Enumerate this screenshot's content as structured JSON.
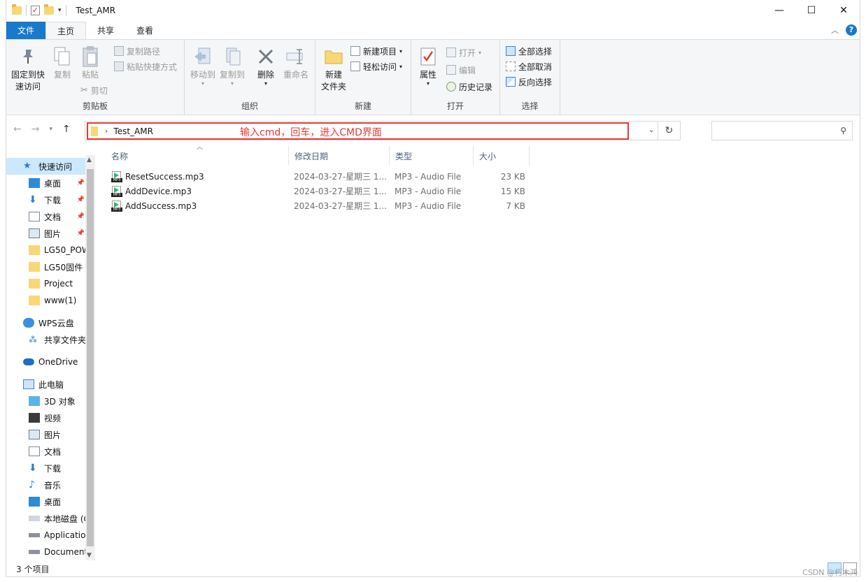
{
  "window": {
    "title": "Test_AMR",
    "controls": {
      "minimize": "—",
      "maximize": "☐",
      "close": "✕"
    }
  },
  "ribbon_tabs": [
    "文件",
    "主页",
    "共享",
    "查看"
  ],
  "ribbon": {
    "clipboard": {
      "label": "剪贴板",
      "pin": "固定到快\n速访问",
      "copy": "复制",
      "paste": "粘贴",
      "copy_path": "复制路径",
      "paste_shortcut": "粘贴快捷方式",
      "cut": "剪切"
    },
    "organize": {
      "label": "组织",
      "move_to": "移动到",
      "copy_to": "复制到",
      "delete": "删除",
      "rename": "重命名"
    },
    "new": {
      "label": "新建",
      "new_folder": "新建\n文件夹",
      "new_item": "新建项目",
      "easy_access": "轻松访问"
    },
    "open": {
      "label": "打开",
      "properties": "属性",
      "open": "打开",
      "edit": "编辑",
      "history": "历史记录"
    },
    "select": {
      "label": "选择",
      "select_all": "全部选择",
      "select_none": "全部取消",
      "invert": "反向选择"
    }
  },
  "address": {
    "path": "Test_AMR",
    "annotation": "输入cmd，回车，进入CMD界面",
    "search_placeholder": ""
  },
  "nav": {
    "quick_access": "快速访问",
    "pinned": [
      "桌面",
      "下载",
      "文档",
      "图片"
    ],
    "folders": [
      "LG50_POW",
      "LG50固件",
      "Project",
      "www(1)"
    ],
    "wps": "WPS云盘",
    "shared": "共享文件夹",
    "onedrive": "OneDrive",
    "this_pc": "此电脑",
    "pc_items": [
      "3D 对象",
      "视频",
      "图片",
      "文档",
      "下载",
      "音乐",
      "桌面",
      "本地磁盘 (C",
      "Applicatio",
      "Document"
    ]
  },
  "columns": [
    "名称",
    "修改日期",
    "类型",
    "大小"
  ],
  "files": [
    {
      "name": "ResetSuccess.mp3",
      "date": "2024-03-27-星期三 1...",
      "type": "MP3 - Audio File",
      "size": "23 KB"
    },
    {
      "name": "AddDevice.mp3",
      "date": "2024-03-27-星期三 1...",
      "type": "MP3 - Audio File",
      "size": "15 KB"
    },
    {
      "name": "AddSuccess.mp3",
      "date": "2024-03-27-星期三 1...",
      "type": "MP3 - Audio File",
      "size": "7 KB"
    }
  ],
  "status": {
    "count": "3 个项目"
  },
  "watermark": "CSDN @朽木鸿"
}
